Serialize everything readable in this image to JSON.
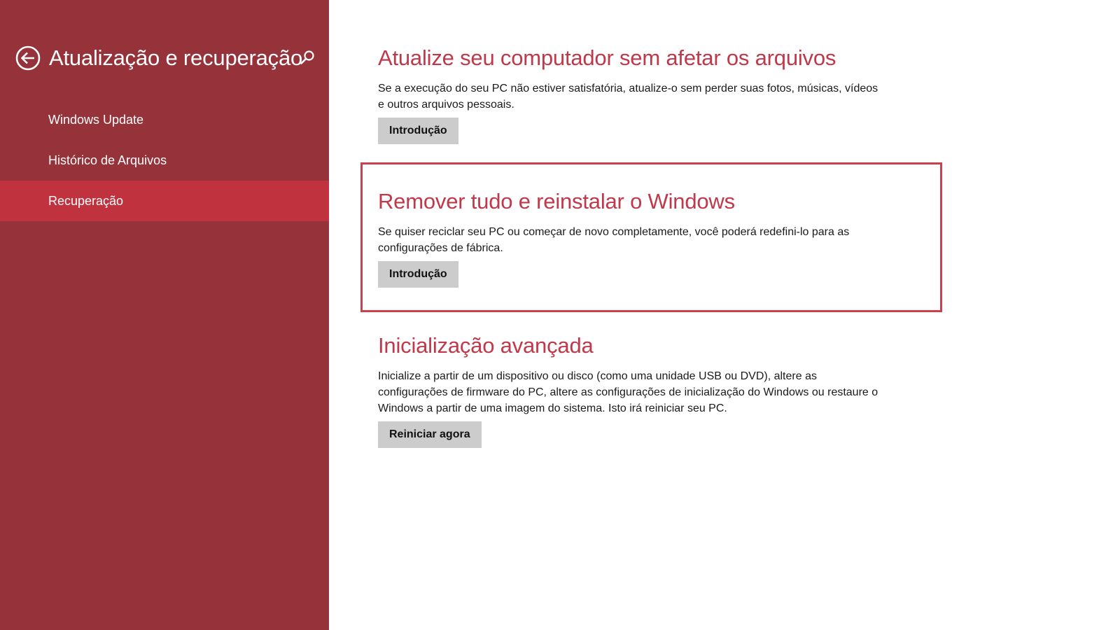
{
  "sidebar": {
    "title": "Atualização e recuperação",
    "items": [
      {
        "label": "Windows Update",
        "active": false
      },
      {
        "label": "Histórico de Arquivos",
        "active": false
      },
      {
        "label": "Recuperação",
        "active": true
      }
    ]
  },
  "sections": [
    {
      "title": "Atualize seu computador sem afetar os arquivos",
      "description": "Se a execução do seu PC não estiver satisfatória, atualize-o sem perder suas fotos, músicas, vídeos e outros arquivos pessoais.",
      "button_label": "Introdução"
    },
    {
      "title": "Remover tudo e reinstalar o Windows",
      "description": "Se quiser reciclar seu PC ou começar de novo completamente, você poderá redefini-lo para as configurações de fábrica.",
      "button_label": "Introdução"
    },
    {
      "title": "Inicialização avançada",
      "description": "Inicialize a partir de um dispositivo ou disco (como uma unidade USB ou DVD), altere as configurações de firmware do PC, altere as configurações de inicialização do Windows ou restaure o Windows a partir de uma imagem do sistema. Isto irá reiniciar seu PC.",
      "button_label": "Reiniciar agora"
    }
  ],
  "colors": {
    "sidebar_bg": "#96323a",
    "sidebar_active": "#c1323f",
    "accent": "#c0394a",
    "highlight": "#c8414d",
    "button_bg": "#cccccc"
  },
  "icons": {
    "back": "back-arrow-icon",
    "search": "search-icon"
  }
}
